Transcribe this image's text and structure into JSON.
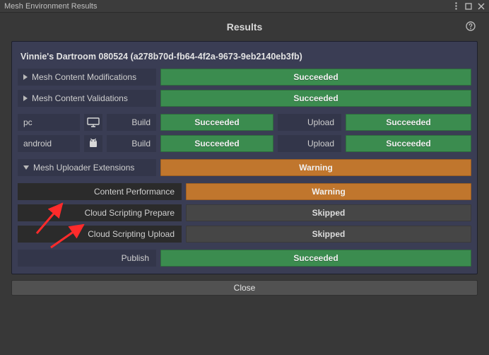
{
  "colors": {
    "success": "#3b8c4f",
    "warning": "#c0762d",
    "skipped": "#464646",
    "panel": "#3a3d54"
  },
  "window": {
    "title": "Mesh Environment Results"
  },
  "header": {
    "title": "Results"
  },
  "environment": {
    "name": "Vinnie's Dartroom 080524",
    "guid": "(a278b70d-fb64-4f2a-9673-9eb2140eb3fb)"
  },
  "top_rows": [
    {
      "label": "Mesh Content Modifications",
      "status": "Succeeded",
      "status_kind": "success"
    },
    {
      "label": "Mesh Content Validations",
      "status": "Succeeded",
      "status_kind": "success"
    }
  ],
  "platforms": {
    "build_label": "Build",
    "upload_label": "Upload",
    "rows": [
      {
        "name": "pc",
        "icon": "pc",
        "build": {
          "text": "Succeeded",
          "kind": "success"
        },
        "upload": {
          "text": "Succeeded",
          "kind": "success"
        }
      },
      {
        "name": "android",
        "icon": "android",
        "build": {
          "text": "Succeeded",
          "kind": "success"
        },
        "upload": {
          "text": "Succeeded",
          "kind": "success"
        }
      }
    ]
  },
  "extensions": {
    "label": "Mesh Uploader Extensions",
    "status": "Warning",
    "status_kind": "warning",
    "children": [
      {
        "label": "Content Performance",
        "status": "Warning",
        "status_kind": "warning"
      },
      {
        "label": "Cloud Scripting Prepare",
        "status": "Skipped",
        "status_kind": "skipped"
      },
      {
        "label": "Cloud Scripting Upload",
        "status": "Skipped",
        "status_kind": "skipped"
      }
    ]
  },
  "publish": {
    "label": "Publish",
    "status": "Succeeded",
    "status_kind": "success"
  },
  "close_label": "Close"
}
